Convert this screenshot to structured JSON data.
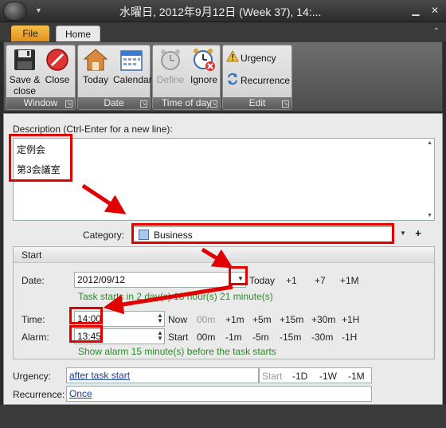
{
  "window": {
    "title": "水曜日, 2012年9月12日 (Week 37), 14:...",
    "minimize": "▁",
    "close": "✕"
  },
  "ribbon": {
    "tabs": [
      {
        "label": "File"
      },
      {
        "label": "Home"
      }
    ],
    "groups": {
      "window": {
        "label": "Window",
        "save_close": "Save &\nclose",
        "close": "Close"
      },
      "date": {
        "label": "Date",
        "today": "Today",
        "calendar": "Calendar"
      },
      "time_of_day": {
        "label": "Time of day",
        "define": "Define",
        "ignore": "Ignore"
      },
      "edit": {
        "label": "Edit",
        "urgency": "Urgency",
        "recurrence": "Recurrence"
      }
    }
  },
  "form": {
    "description_label": "Description (Ctrl-Enter for a new line):",
    "description_lines": [
      "定例会",
      "第3会議室"
    ],
    "category_label": "Category:",
    "category_value": "Business",
    "category_plus": "+",
    "start": {
      "heading": "Start",
      "date_label": "Date:",
      "date_value": "2012/09/12",
      "date_quick": [
        "Today",
        "+1",
        "+7",
        "+1M"
      ],
      "date_note": "Task starts in 2 day(s) 18 hour(s) 21 minute(s)",
      "time_label": "Time:",
      "time_value": "14:00",
      "time_quick": [
        "Now",
        "00m",
        "+1m",
        "+5m",
        "+15m",
        "+30m",
        "+1H"
      ],
      "alarm_label": "Alarm:",
      "alarm_value": "13:45",
      "alarm_quick": [
        "Start",
        "00m",
        "-1m",
        "-5m",
        "-15m",
        "-30m",
        "-1H"
      ],
      "alarm_note": "Show alarm 15 minute(s) before the task starts"
    },
    "urgency_label": "Urgency:",
    "urgency_value": "after task start",
    "urgency_quick": [
      "Start",
      "-1D",
      "-1W",
      "-1M"
    ],
    "recurrence_label": "Recurrence:",
    "recurrence_value": "Once"
  },
  "colors": {
    "annotation": "#e10000",
    "note_green": "#2a8a2a",
    "file_tab": "#e0901c"
  }
}
